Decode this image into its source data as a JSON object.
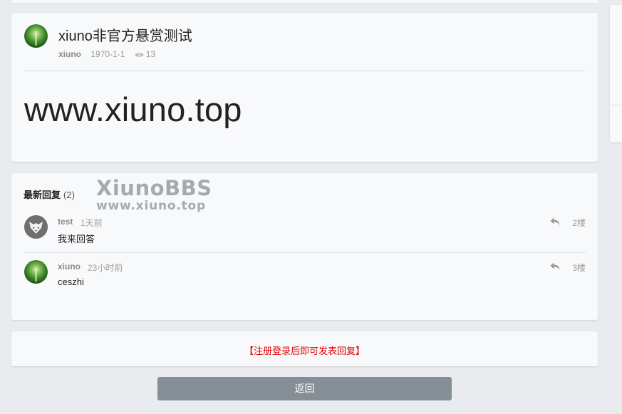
{
  "thread": {
    "title": "xiuno非官方悬赏测试",
    "author": "xiuno",
    "date": "1970-1-1",
    "views": "13",
    "body": "www.xiuno.top"
  },
  "replies_section": {
    "header": "最新回复",
    "count": "(2)",
    "watermark_line1": "XiunoBBS",
    "watermark_line2": "www.xiuno.top",
    "items": [
      {
        "author": "test",
        "time": "1天前",
        "text": "我来回答",
        "floor": "2楼",
        "avatar": "wolf-logo"
      },
      {
        "author": "xiuno",
        "time": "23小时前",
        "text": "ceszhi",
        "floor": "3楼",
        "avatar": "forest-photo"
      }
    ]
  },
  "login_prompt": "【注册登录后即可发表回复】",
  "back_button_label": "返回",
  "icons": {
    "views": "eye-icon",
    "reply": "reply-arrow-icon"
  },
  "colors": {
    "page_bg": "#e9ebee",
    "card_bg": "#f8f9fb",
    "login_prompt": "#e60000",
    "back_button": "#868e96"
  }
}
